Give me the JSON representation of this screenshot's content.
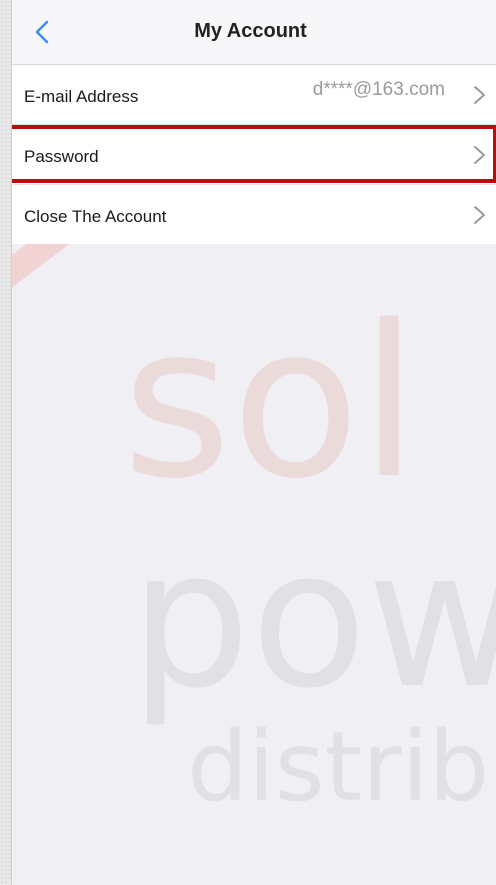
{
  "navbar": {
    "title": "My Account"
  },
  "rows": [
    {
      "label": "E-mail Address",
      "value": "d****@163.com"
    },
    {
      "label": "Password",
      "value": ""
    },
    {
      "label": "Close The Account",
      "value": ""
    }
  ],
  "watermark": {
    "line1": "sol",
    "line2": "pow",
    "line3": "distrib"
  },
  "colors": {
    "highlight": "#b30f0f",
    "accent": "#3b8ef0",
    "background": "#efeff4"
  },
  "icons": {
    "back": "chevron-left-icon",
    "row_arrow": "chevron-right-icon"
  }
}
